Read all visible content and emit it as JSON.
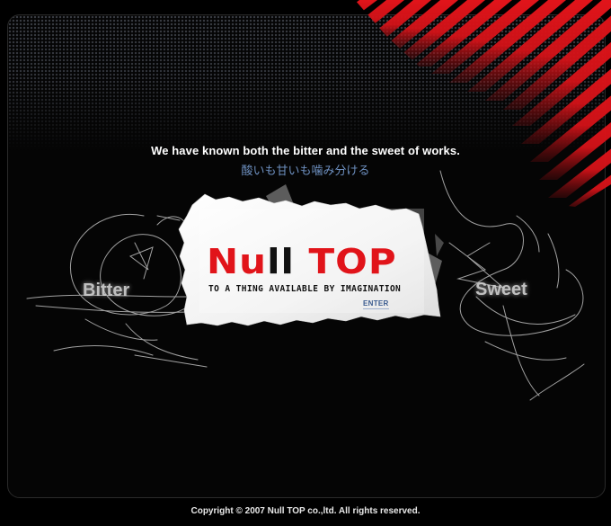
{
  "page": {
    "tagline_en": "We have known both the bitter and the sweet of works.",
    "tagline_jp": "酸いも甘いも噛み分ける",
    "side_left": "Bitter",
    "side_right": "Sweet",
    "footer": "Copyright © 2007 Null TOP co.,ltd. All rights reserved."
  },
  "logo": {
    "part_a": "Nu",
    "part_b": "ll ",
    "part_c": "TOP",
    "tagline": "TO A THING AVAILABLE BY IMAGINATION",
    "enter_label": "ENTER"
  },
  "colors": {
    "accent_red": "#e1141a",
    "link_blue": "#3a5b8f",
    "jp_blue": "#6d8fbf",
    "background": "#000000"
  },
  "icons": {
    "decoration": "red-diagonal-stripes",
    "scribbles": "white-pen-scribbles"
  }
}
